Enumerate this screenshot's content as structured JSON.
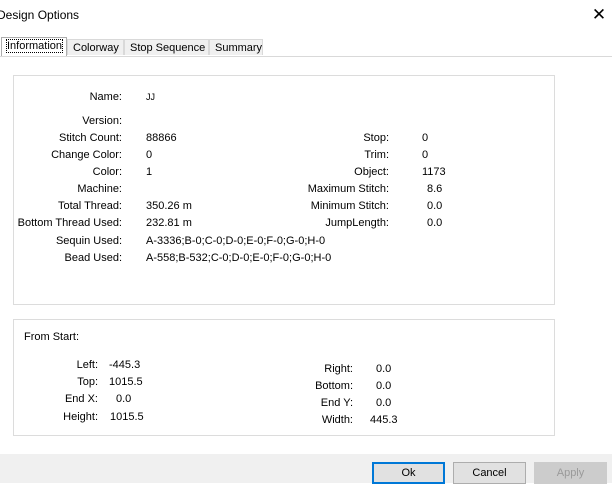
{
  "window": {
    "title": "Design Options",
    "close_glyph": "✕"
  },
  "tabs": [
    {
      "label": "Information"
    },
    {
      "label": "Colorway"
    },
    {
      "label": "Stop Sequence"
    },
    {
      "label": "Summary"
    }
  ],
  "info": {
    "name_label": "Name:",
    "name_value": "JJ",
    "version_label": "Version:",
    "version_value": "",
    "stitch_count_label": "Stitch Count:",
    "stitch_count_value": "88866",
    "change_color_label": "Change Color:",
    "change_color_value": "0",
    "color_label": "Color:",
    "color_value": "1",
    "machine_label": "Machine:",
    "machine_value": "",
    "total_thread_label": "Total Thread:",
    "total_thread_value": "350.26 m",
    "bottom_thread_label": "Bottom Thread Used:",
    "bottom_thread_value": "232.81 m",
    "sequin_label": "Sequin Used:",
    "sequin_value": "A-3336;B-0;C-0;D-0;E-0;F-0;G-0;H-0",
    "bead_label": "Bead Used:",
    "bead_value": "A-558;B-532;C-0;D-0;E-0;F-0;G-0;H-0",
    "stop_label": "Stop:",
    "stop_value": "0",
    "trim_label": "Trim:",
    "trim_value": "0",
    "object_label": "Object:",
    "object_value": "1173",
    "max_stitch_label": "Maximum Stitch:",
    "max_stitch_value": "8.6",
    "min_stitch_label": "Minimum Stitch:",
    "min_stitch_value": "0.0",
    "jump_length_label": "JumpLength:",
    "jump_length_value": "0.0"
  },
  "from_start": {
    "heading": "From Start:",
    "left_label": "Left:",
    "left_value": "-445.3",
    "top_label": "Top:",
    "top_value": "1015.5",
    "endx_label": "End X:",
    "endx_value": "0.0",
    "height_label": "Height:",
    "height_value": "1015.5",
    "right_label": "Right:",
    "right_value": "0.0",
    "bottom_label": "Bottom:",
    "bottom_value": "0.0",
    "endy_label": "End Y:",
    "endy_value": "0.0",
    "width_label": "Width:",
    "width_value": "445.3"
  },
  "buttons": {
    "ok": "Ok",
    "cancel": "Cancel",
    "apply": "Apply"
  },
  "colors": {
    "accent": "#0078d7",
    "face": "#f0f0f0",
    "border": "#dcdcdc"
  }
}
